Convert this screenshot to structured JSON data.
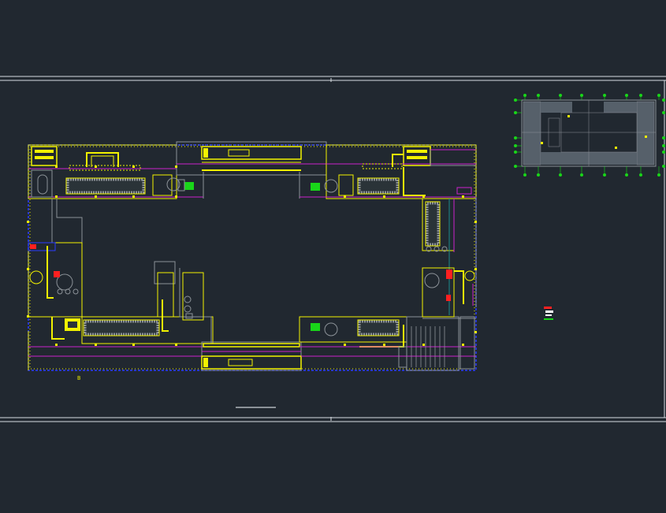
{
  "drawing": {
    "scale_text": "B"
  },
  "colors": {
    "background": "#212830",
    "frame": "#d8dde2",
    "wall_yellow": "#f2f200",
    "boundary_blue": "#2a3cff",
    "magenta": "#cc22cc",
    "green": "#19d619",
    "red": "#ff2020",
    "gray": "#8c9298",
    "white": "#ffffff"
  }
}
